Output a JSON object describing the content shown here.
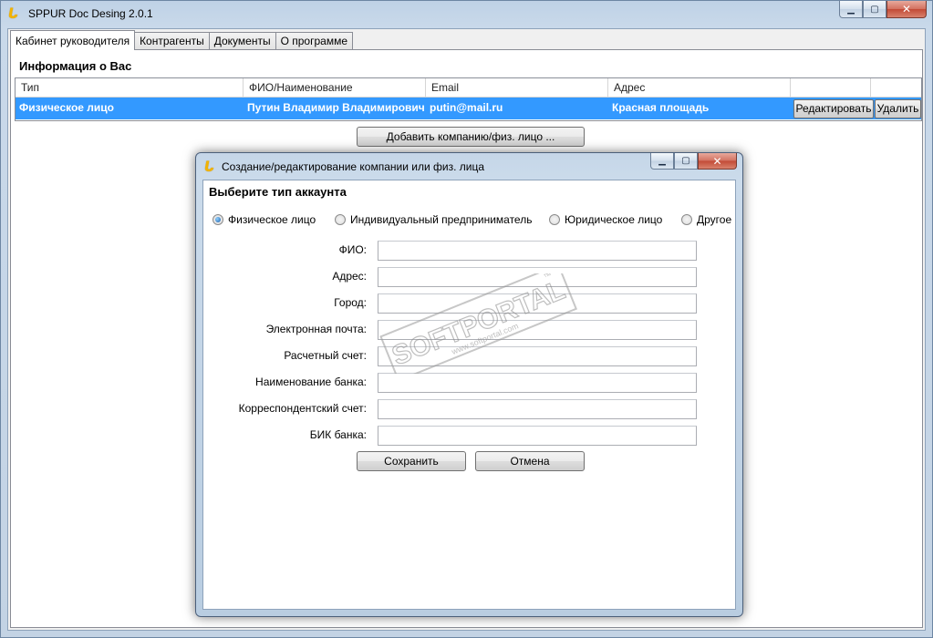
{
  "window": {
    "title": "SPPUR Doc Desing 2.0.1",
    "icon": "app-logo-icon"
  },
  "tabs": [
    {
      "label": "Кабинет руководителя",
      "active": true
    },
    {
      "label": "Контрагенты",
      "active": false
    },
    {
      "label": "Документы",
      "active": false
    },
    {
      "label": "О программе",
      "active": false
    }
  ],
  "main": {
    "section_title": "Информация о Вас",
    "columns": [
      "Тип",
      "ФИО/Наименование",
      "Email",
      "Адрес"
    ],
    "rows": [
      {
        "type": "Физическое лицо",
        "name": "Путин Владимир Владимирович",
        "email": "putin@mail.ru",
        "address": "Красная площадь",
        "edit_label": "Редактировать",
        "delete_label": "Удалить"
      }
    ],
    "add_button": "Добавить компанию/физ. лицо ..."
  },
  "dialog": {
    "title": "Создание/редактирование компании или физ. лица",
    "heading": "Выберите тип аккаунта",
    "account_types": [
      {
        "label": "Физическое лицо",
        "checked": true
      },
      {
        "label": "Индивидуальный предприниматель",
        "checked": false
      },
      {
        "label": "Юридическое лицо",
        "checked": false
      },
      {
        "label": "Другое",
        "checked": false
      }
    ],
    "fields": [
      {
        "label": "ФИО:",
        "value": ""
      },
      {
        "label": "Адрес:",
        "value": ""
      },
      {
        "label": "Город:",
        "value": ""
      },
      {
        "label": "Электронная почта:",
        "value": ""
      },
      {
        "label": "Расчетный счет:",
        "value": ""
      },
      {
        "label": "Наименование банка:",
        "value": ""
      },
      {
        "label": "Корреспондентский счет:",
        "value": ""
      },
      {
        "label": "БИК банка:",
        "value": ""
      }
    ],
    "save_label": "Сохранить",
    "cancel_label": "Отмена"
  },
  "watermark": {
    "brand": "SOFTPORTAL",
    "url": "www.softportal.com",
    "mark": "™"
  },
  "colors": {
    "selection": "#3399ff",
    "window_frame": "#c3d3e4",
    "close_button": "#c24a36"
  }
}
